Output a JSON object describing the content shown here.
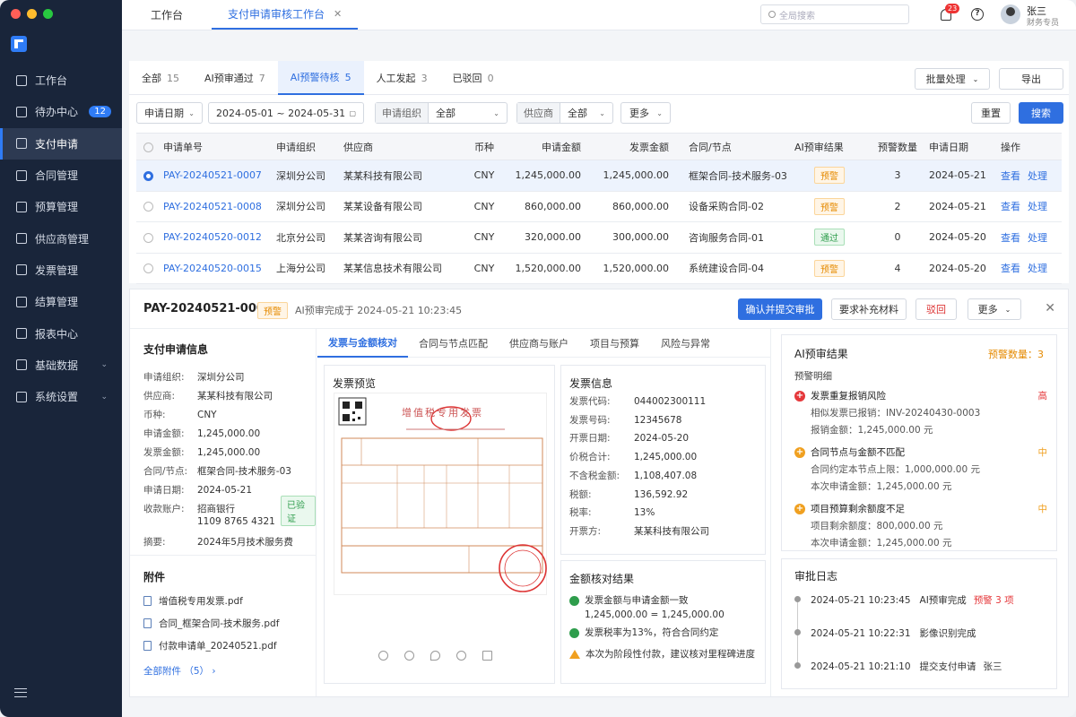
{
  "window": {
    "dots": [
      "#ff5f57",
      "#febc2e",
      "#28c840"
    ]
  },
  "sidebar": {
    "items": [
      {
        "label": "工作台"
      },
      {
        "label": "待办中心",
        "badge": "12"
      },
      {
        "label": "支付申请",
        "active": true
      },
      {
        "label": "合同管理"
      },
      {
        "label": "预算管理"
      },
      {
        "label": "供应商管理"
      },
      {
        "label": "发票管理"
      },
      {
        "label": "结算管理"
      },
      {
        "label": "报表中心"
      },
      {
        "label": "基础数据",
        "chev": "⌄"
      },
      {
        "label": "系统设置",
        "chev": "⌄"
      }
    ]
  },
  "topbar": {
    "tab_home": "工作台",
    "tab_active": "支付申请审核工作台",
    "close": "✕",
    "search_placeholder": "全局搜索",
    "bell_count": "23",
    "help": "?",
    "user_name": "张三",
    "user_role": "财务专员"
  },
  "subtabs": [
    {
      "label": "全部",
      "count": "15"
    },
    {
      "label": "AI预审通过",
      "count": "7"
    },
    {
      "label": "AI预警待核",
      "count": "5",
      "active": true
    },
    {
      "label": "人工发起",
      "count": "3"
    },
    {
      "label": "已驳回",
      "count": "0"
    }
  ],
  "actions": {
    "batch": "批量处理",
    "export": "导出",
    "reset": "重置",
    "search": "搜索"
  },
  "filters": {
    "date_label": "申请日期",
    "date_range": "2024-05-01  ~  2024-05-31",
    "org_label": "申请组织",
    "org_value": "全部",
    "vendor_label": "供应商",
    "vendor_value": "全部",
    "more": "更多"
  },
  "table": {
    "headers": [
      "申请单号",
      "申请组织",
      "供应商",
      "币种",
      "申请金额",
      "发票金额",
      "合同/节点",
      "AI预审结果",
      "预警数量",
      "申请日期",
      "操作"
    ],
    "rows": [
      {
        "id": "PAY-20240521-0007",
        "org": "深圳分公司",
        "vendor": "某某科技有限公司",
        "cur": "CNY",
        "amount": "1,245,000.00",
        "invoice": "1,245,000.00",
        "contract": "框架合同-技术服务-03",
        "result": "预警",
        "rtype": "warn",
        "warn": "3",
        "date": "2024-05-21",
        "selected": true
      },
      {
        "id": "PAY-20240521-0008",
        "org": "深圳分公司",
        "vendor": "某某设备有限公司",
        "cur": "CNY",
        "amount": "860,000.00",
        "invoice": "860,000.00",
        "contract": "设备采购合同-02",
        "result": "预警",
        "rtype": "warn",
        "warn": "2",
        "date": "2024-05-21"
      },
      {
        "id": "PAY-20240520-0012",
        "org": "北京分公司",
        "vendor": "某某咨询有限公司",
        "cur": "CNY",
        "amount": "320,000.00",
        "invoice": "300,000.00",
        "contract": "咨询服务合同-01",
        "result": "通过",
        "rtype": "ok",
        "warn": "0",
        "date": "2024-05-20"
      },
      {
        "id": "PAY-20240520-0015",
        "org": "上海分公司",
        "vendor": "某某信息技术有限公司",
        "cur": "CNY",
        "amount": "1,520,000.00",
        "invoice": "1,520,000.00",
        "contract": "系统建设合同-04",
        "result": "预警",
        "rtype": "warn",
        "warn": "4",
        "date": "2024-05-20"
      }
    ],
    "op_view": "查看",
    "op_handle": "处理"
  },
  "detail": {
    "title": "PAY-20240521-0007",
    "tag": "预警",
    "subtitle": "AI预审完成于 2024-05-21 10:23:45",
    "btn_confirm": "确认并提交审批",
    "btn_supplement": "要求补充材料",
    "btn_reject": "驳回",
    "btn_more": "更多",
    "info_title": "支付申请信息",
    "info": [
      {
        "k": "申请组织:",
        "v": "深圳分公司"
      },
      {
        "k": "供应商:",
        "v": "某某科技有限公司"
      },
      {
        "k": "币种:",
        "v": "CNY"
      },
      {
        "k": "申请金额:",
        "v": "1,245,000.00"
      },
      {
        "k": "发票金额:",
        "v": "1,245,000.00"
      },
      {
        "k": "合同/节点:",
        "v": "框架合同-技术服务-03"
      },
      {
        "k": "申请日期:",
        "v": "2024-05-21"
      },
      {
        "k": "收款账户:",
        "v": "招商银行"
      },
      {
        "k": "",
        "v": "1109 8765 4321"
      },
      {
        "k": "摘要:",
        "v": "2024年5月技术服务费"
      }
    ],
    "verified": "已验证",
    "attach_title": "附件",
    "files": [
      "增值税专用发票.pdf",
      "合同_框架合同-技术服务.pdf",
      "付款申请单_20240521.pdf"
    ],
    "all_files": "全部附件 （5） ›",
    "tabs": [
      "发票与金额核对",
      "合同与节点匹配",
      "供应商与账户",
      "项目与预算",
      "风险与异常"
    ],
    "preview_title": "发票预览",
    "invoice_header": "增值税专用发票",
    "invoice_info_title": "发票信息",
    "invoice_info": [
      {
        "k": "发票代码:",
        "v": "044002300111"
      },
      {
        "k": "发票号码:",
        "v": "12345678"
      },
      {
        "k": "开票日期:",
        "v": "2024-05-20"
      },
      {
        "k": "价税合计:",
        "v": "1,245,000.00"
      },
      {
        "k": "不含税金额:",
        "v": "1,108,407.08"
      },
      {
        "k": "税额:",
        "v": "136,592.92"
      },
      {
        "k": "税率:",
        "v": "13%"
      },
      {
        "k": "开票方:",
        "v": "某某科技有限公司"
      }
    ],
    "check_title": "金额核对结果",
    "checks": [
      {
        "text": "发票金额与申请金额一致",
        "sub": "1,245,000.00 = 1,245,000.00",
        "type": "ok"
      },
      {
        "text": "发票税率为13%，符合合同约定",
        "type": "ok"
      },
      {
        "text": "本次为阶段性付款，建议核对里程碑进度",
        "type": "warn"
      }
    ],
    "ai_title": "AI预审结果",
    "ai_count": "预警数量：3",
    "ai_sub": "预警明细",
    "risks": [
      {
        "title": "发票重复报销风险",
        "level": "高",
        "color": "#e5383b",
        "lines": [
          "相似发票已报销：INV-20240430-0003",
          "报销金额：1,245,000.00 元"
        ]
      },
      {
        "title": "合同节点与金额不匹配",
        "level": "中",
        "color": "#f0a020",
        "lines": [
          "合同约定本节点上限：1,000,000.00 元",
          "本次申请金额：1,245,000.00 元"
        ]
      },
      {
        "title": "项目预算剩余额度不足",
        "level": "中",
        "color": "#f0a020",
        "lines": [
          "项目剩余额度：800,000.00 元",
          "本次申请金额：1,245,000.00 元"
        ]
      }
    ],
    "log_title": "审批日志",
    "logs": [
      {
        "time": "2024-05-21 10:23:45",
        "text": "AI预审完成",
        "extra": "预警 3 项"
      },
      {
        "time": "2024-05-21 10:22:31",
        "text": "影像识别完成",
        "extra": ""
      },
      {
        "time": "2024-05-21 10:21:10",
        "text": "提交支付申请",
        "extra": "张三"
      }
    ]
  }
}
